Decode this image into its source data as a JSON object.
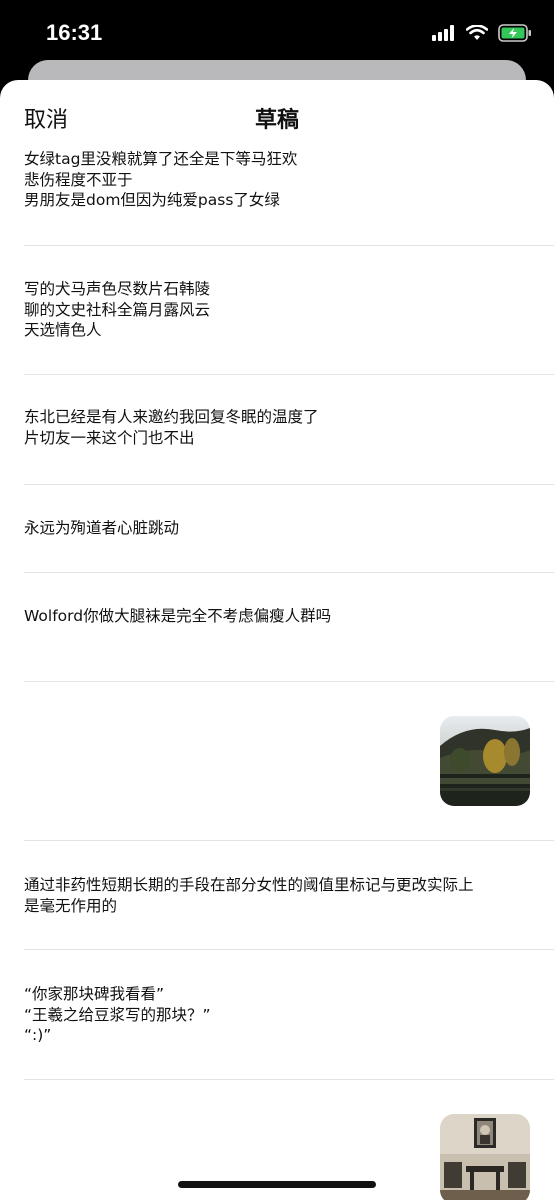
{
  "status": {
    "time": "16:31"
  },
  "header": {
    "cancel_label": "取消",
    "title": "草稿"
  },
  "drafts": [
    {
      "text": "女绿tag里没粮就算了还全是下等马狂欢\n悲伤程度不亚于\n男朋友是dom但因为纯爱pass了女绿"
    },
    {
      "text": "写的犬马声色尽数片石韩陵\n聊的文史社科全篇月露风云\n天选情色人"
    },
    {
      "text": "东北已经是有人来邀约我回复冬眠的温度了\n片切友一来这个门也不出"
    },
    {
      "text": "永远为殉道者心脏跳动"
    },
    {
      "text": "Wolford你做大腿袜是完全不考虑偏瘦人群吗"
    },
    {
      "image": "landscape-lake-trees-photo"
    },
    {
      "text": "通过非药性短期长期的手段在部分女性的阈值里标记与更改实际上\n是毫无作用的"
    },
    {
      "text": "“你家那块碑我看看”\n“王羲之给豆浆写的那块？”\n“:)”"
    },
    {
      "image": "portrait-room-photo"
    }
  ]
}
